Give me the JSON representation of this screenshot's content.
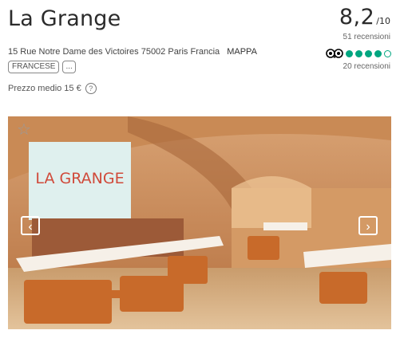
{
  "restaurant": {
    "name": "La Grange",
    "address": "15 Rue Notre Dame des Victoires 75002 Paris Francia",
    "map_link": "MAPPA",
    "tags": [
      "FRANCESE",
      "..."
    ],
    "avg_price": "Prezzo medio 15 €",
    "help_icon": "?"
  },
  "rating": {
    "score": "8,2",
    "scale": "/10",
    "reviews": "51 recensioni"
  },
  "tripadvisor": {
    "logo_icon": "tripadvisor-owl-icon",
    "bubbles_filled": 4,
    "bubbles_total": 5,
    "reviews": "20 recensioni"
  },
  "gallery": {
    "sign_text": "LA GRANGE",
    "favorite_icon": "☆",
    "prev_icon": "‹",
    "next_icon": "›"
  },
  "colors": {
    "tripadvisor_green": "#00a680",
    "wall": "#c98a55",
    "chairs": "#c86a2a"
  }
}
